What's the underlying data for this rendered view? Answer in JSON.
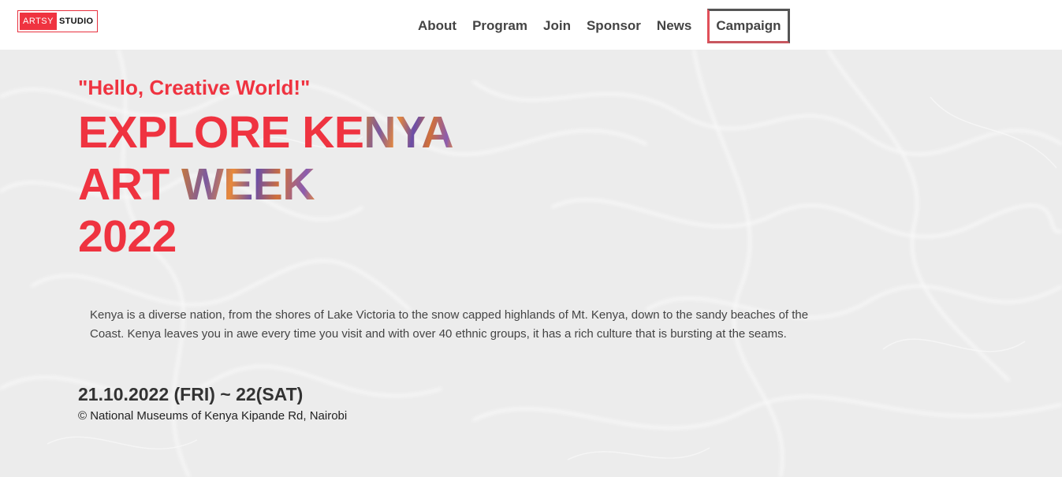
{
  "header": {
    "logo": {
      "part1": "ARTSY",
      "part2": "STUDIO"
    },
    "nav": [
      {
        "label": "About"
      },
      {
        "label": "Program"
      },
      {
        "label": "Join"
      },
      {
        "label": "Sponsor"
      },
      {
        "label": "News"
      },
      {
        "label": "Campaign"
      }
    ]
  },
  "hero": {
    "tagline": "\"Hello, Creative World!\"",
    "title": {
      "line1_plain": "EXPLORE KE",
      "line1_art": "NYA",
      "line2_plain": "ART ",
      "line2_art": "WEEK",
      "line3": "2022"
    },
    "description": "Kenya is a diverse nation, from the shores of Lake Victoria to the snow capped highlands of Mt. Kenya, down to the sandy beaches of the Coast. Kenya leaves you in awe every time you visit and with over 40 ethnic groups, it has a rich culture that is bursting at the seams.",
    "date": "21.10.2022 (FRI) ~ 22(SAT)",
    "venue": "© National Museums of Kenya Kipande Rd, Nairobi"
  },
  "colors": {
    "accent": "#ef3340",
    "nav_text": "#444444",
    "hero_background": "#eeeeee"
  }
}
